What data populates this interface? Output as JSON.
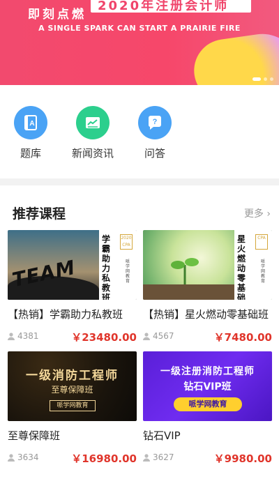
{
  "banner": {
    "line1": "即刻点燃",
    "year_title": "2020年注册会计师",
    "slogan": "A SINGLE SPARK CAN START A PRAIRIE FIRE",
    "pager_total": 3,
    "pager_active": 1
  },
  "nav": [
    {
      "label": "题库",
      "icon": "question-bank-icon",
      "color": "#4aa3f5"
    },
    {
      "label": "新闻资讯",
      "icon": "news-icon",
      "color": "#2ccf8d"
    },
    {
      "label": "问答",
      "icon": "qa-icon",
      "color": "#4aa3f5"
    }
  ],
  "section": {
    "title": "推荐课程",
    "more": "更多"
  },
  "courses": [
    {
      "title": "【热销】学霸助力私教班",
      "sales": "4381",
      "price": "￥23480.00",
      "thumb": {
        "vertical": "学霸助力私教班",
        "badge_year": "2020",
        "badge_text": "CPA",
        "small": "哌学网教育",
        "art_text": "TEAM"
      }
    },
    {
      "title": "【热销】星火燃动零基础班",
      "sales": "4567",
      "price": "￥7480.00",
      "thumb": {
        "vertical": "星火燃动零基础",
        "badge_text": "CPA",
        "small": "哌学网教育"
      }
    },
    {
      "title": "至尊保障班",
      "sales": "3634",
      "price": "￥16980.00",
      "thumb": {
        "heading": "一级消防工程师",
        "sub": "至尊保障班",
        "brand": "哌学网教育"
      }
    },
    {
      "title": "钻石VIP",
      "sales": "3627",
      "price": "￥9980.00",
      "thumb": {
        "heading": "一级注册消防工程师",
        "sub": "钻石VIP班",
        "brand": "哌学网教育"
      }
    }
  ],
  "colors": {
    "price": "#e0352b",
    "banner": "#f24a6e"
  }
}
